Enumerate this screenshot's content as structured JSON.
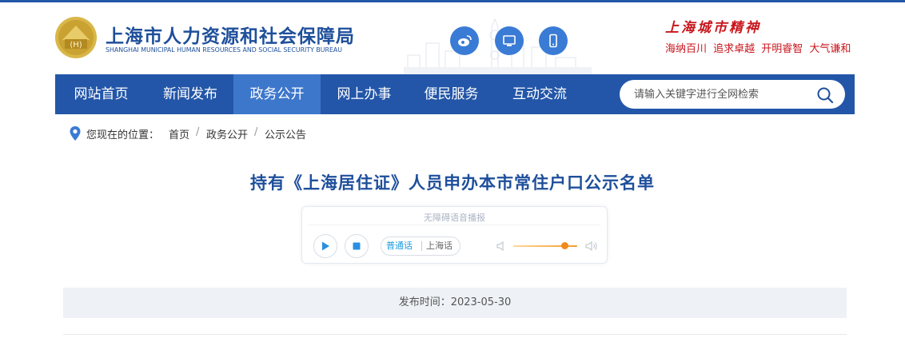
{
  "header": {
    "site_title": "上海市人力资源和社会保障局",
    "site_subtitle": "SHANGHAI MUNICIPAL HUMAN RESOURCES AND SOCIAL SECURITY BUREAU",
    "emblem_text": "(H)",
    "social_icons": [
      "weibo-icon",
      "desktop-icon",
      "mobile-icon"
    ],
    "spirit_title": "上海城市精神",
    "spirit_words": "海纳百川 追求卓越 开明睿智 大气谦和"
  },
  "nav": {
    "items": [
      {
        "label": "网站首页",
        "active": false
      },
      {
        "label": "新闻发布",
        "active": false
      },
      {
        "label": "政务公开",
        "active": true
      },
      {
        "label": "网上办事",
        "active": false
      },
      {
        "label": "便民服务",
        "active": false
      },
      {
        "label": "互动交流",
        "active": false
      }
    ],
    "search_placeholder": "请输入关键字进行全网检索"
  },
  "breadcrumb": {
    "label": "您现在的位置：",
    "items": [
      "首页",
      "政务公开",
      "公示公告"
    ],
    "separator": "/"
  },
  "article": {
    "title": "持有《上海居住证》人员申办本市常住户口公示名单",
    "publish_label": "发布时间：",
    "publish_date": "2023-05-30"
  },
  "player": {
    "label": "无障碍语音播报",
    "lang_mandarin": "普通话",
    "lang_shanghai": "上海话",
    "volume_fraction": 0.8
  },
  "colors": {
    "brand_blue": "#2356a8",
    "nav_active": "#3d77cc",
    "title_blue": "#1e4f9b",
    "spirit_red": "#c8161d",
    "volume_orange": "#f08a1c"
  }
}
